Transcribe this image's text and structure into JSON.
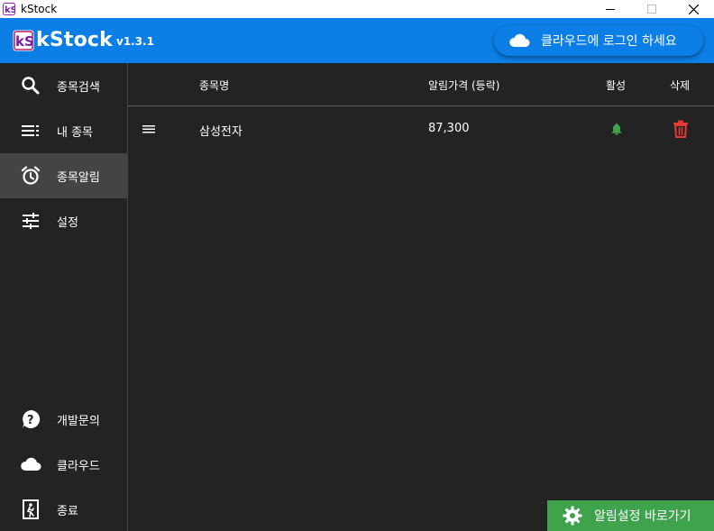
{
  "window": {
    "title": "kStock",
    "logo_mark": "kS"
  },
  "header": {
    "brand": "kStock",
    "version": "v1.3.1",
    "cloud_login_label": "클라우드에 로그인 하세요"
  },
  "sidebar": {
    "items": [
      {
        "label": "종목검색",
        "icon": "search-icon"
      },
      {
        "label": "내 종목",
        "icon": "list-icon"
      },
      {
        "label": "종목알림",
        "icon": "alarm-clock-icon",
        "active": true
      },
      {
        "label": "설정",
        "icon": "sliders-icon"
      }
    ],
    "bottom_items": [
      {
        "label": "개발문의",
        "icon": "help-icon"
      },
      {
        "label": "클라우드",
        "icon": "cloud-icon"
      },
      {
        "label": "종료",
        "icon": "exit-icon"
      }
    ]
  },
  "table": {
    "headers": {
      "name": "종목명",
      "price": "알림가격 (등락)",
      "active": "활성",
      "delete": "삭제"
    },
    "rows": [
      {
        "name": "삼성전자",
        "price": "87,300",
        "active": true
      }
    ]
  },
  "footer": {
    "alarm_settings_label": "알림설정 바로가기"
  },
  "colors": {
    "header_blue": "#0c7fe6",
    "sidebar_bg": "#232323",
    "active_bg": "#444444",
    "bell_green": "#43a047",
    "delete_red": "#e53935",
    "button_green": "#3fa34d"
  }
}
